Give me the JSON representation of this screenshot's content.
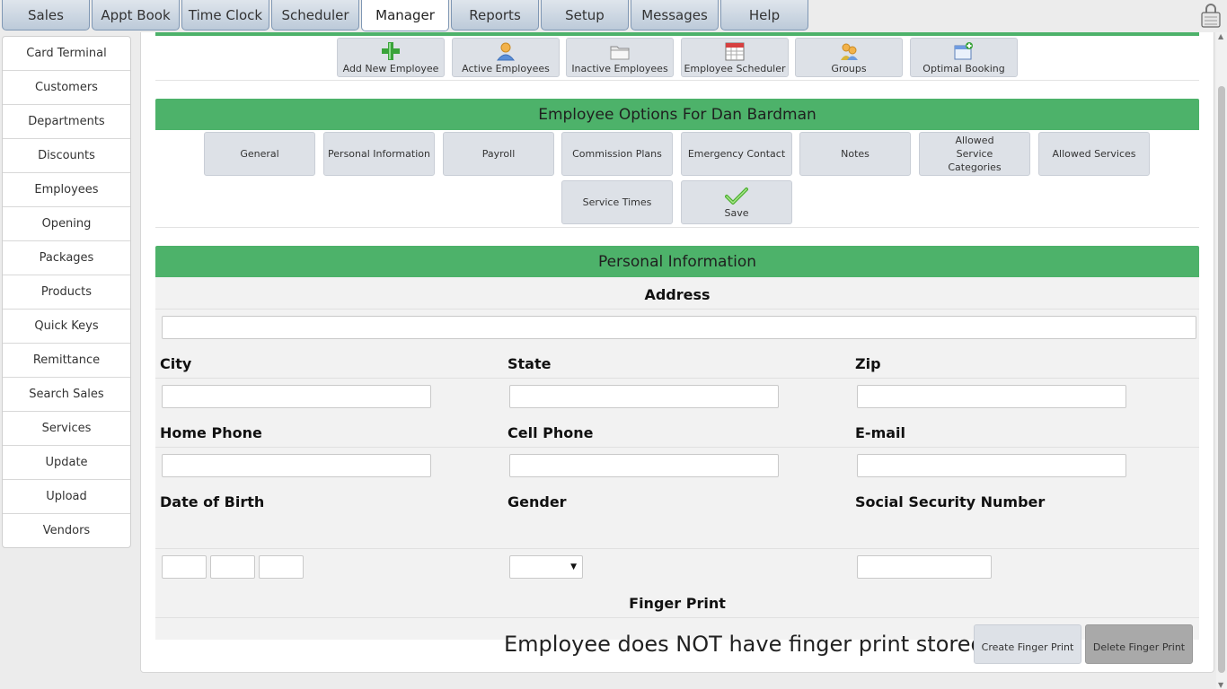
{
  "top_tabs": [
    "Sales",
    "Appt Book",
    "Time Clock",
    "Scheduler",
    "Manager",
    "Reports",
    "Setup",
    "Messages",
    "Help"
  ],
  "active_tab": "Manager",
  "sidebar": {
    "items": [
      "Card Terminal",
      "Customers",
      "Departments",
      "Discounts",
      "Employees",
      "Opening",
      "Packages",
      "Products",
      "Quick Keys",
      "Remittance",
      "Search Sales",
      "Services",
      "Update",
      "Upload",
      "Vendors"
    ]
  },
  "toolbar": {
    "items": [
      {
        "label": "Add New Employee",
        "icon": "add-person-icon"
      },
      {
        "label": "Active Employees",
        "icon": "person-icon"
      },
      {
        "label": "Inactive Employees",
        "icon": "folder-icon"
      },
      {
        "label": "Employee Scheduler",
        "icon": "calendar-icon"
      },
      {
        "label": "Groups",
        "icon": "group-icon"
      },
      {
        "label": "Optimal Booking",
        "icon": "booking-icon"
      }
    ]
  },
  "options": {
    "title": "Employee Options For Dan Bardman",
    "buttons": [
      "General",
      "Personal Information",
      "Payroll",
      "Commission Plans",
      "Emergency Contact",
      "Notes",
      "Allowed Service Categories",
      "Allowed Services"
    ],
    "row2": [
      "Service Times"
    ],
    "save_label": "Save"
  },
  "personal": {
    "title": "Personal Information",
    "address_heading": "Address",
    "city_label": "City",
    "state_label": "State",
    "zip_label": "Zip",
    "home_phone_label": "Home Phone",
    "cell_phone_label": "Cell Phone",
    "email_label": "E-mail",
    "dob_label": "Date of Birth",
    "gender_label": "Gender",
    "ssn_label": "Social Security Number",
    "finger_heading": "Finger Print",
    "finger_message": "Employee does NOT have finger print stored",
    "create_fp_label": "Create Finger Print",
    "delete_fp_label": "Delete Finger Print"
  },
  "colors": {
    "accent_green": "#4db26a",
    "button_gray": "#dde1e7",
    "delete_button": "#a9a9a9"
  }
}
